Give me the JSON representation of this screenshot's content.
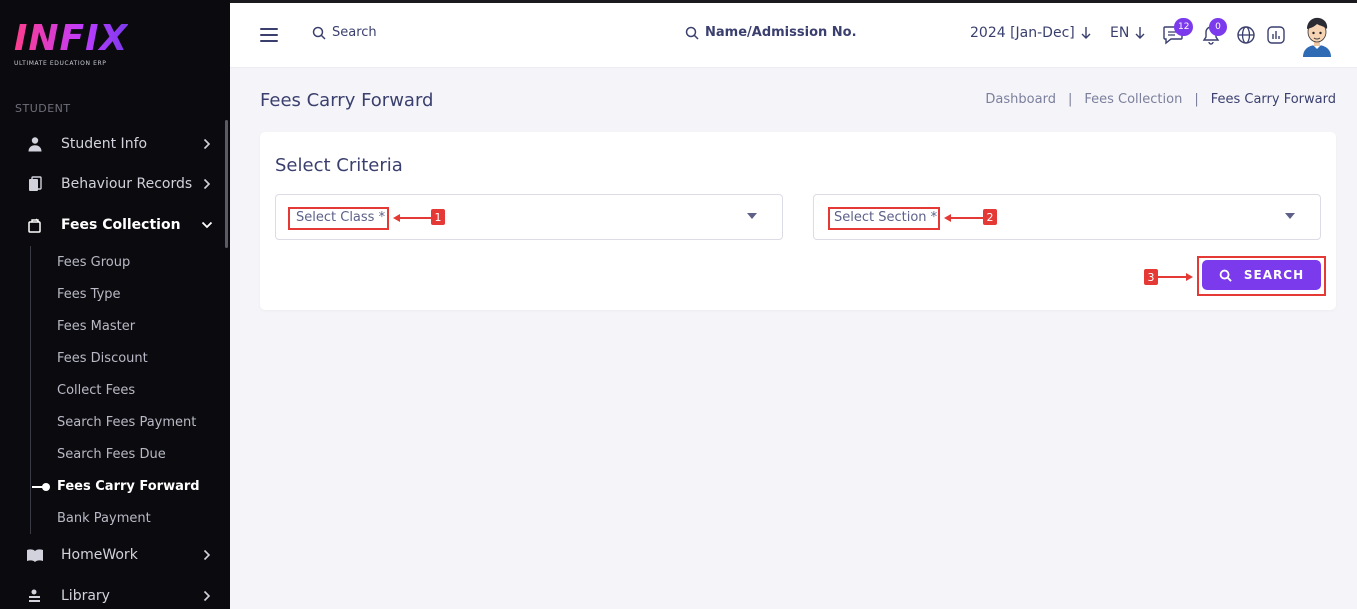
{
  "brand": {
    "logo": "INFIX",
    "tagline": "ULTIMATE EDUCATION ERP"
  },
  "sidebar": {
    "section": "STUDENT",
    "items": [
      {
        "label": "Student Info",
        "icon": "user-icon"
      },
      {
        "label": "Behaviour Records",
        "icon": "clipboard-icon"
      },
      {
        "label": "Fees Collection",
        "icon": "fees-icon"
      },
      {
        "label": "HomeWork",
        "icon": "book-icon"
      },
      {
        "label": "Library",
        "icon": "library-icon"
      }
    ],
    "sub_items": [
      "Fees Group",
      "Fees Type",
      "Fees Master",
      "Fees Discount",
      "Collect Fees",
      "Search Fees Payment",
      "Search Fees Due",
      "Fees Carry Forward",
      "Bank Payment"
    ]
  },
  "header": {
    "search_label": "Search",
    "admission_search": "Name/Admission No.",
    "year": "2024 [Jan-Dec]",
    "lang": "EN",
    "messages_count": "12",
    "notifications_count": "0"
  },
  "page": {
    "title": "Fees Carry Forward",
    "breadcrumb": [
      "Dashboard",
      "Fees Collection",
      "Fees Carry Forward"
    ]
  },
  "criteria": {
    "title": "Select Criteria",
    "class_placeholder": "Select Class *",
    "section_placeholder": "Select Section *",
    "search_button": "SEARCH"
  },
  "annotations": [
    "1",
    "2",
    "3"
  ],
  "colors": {
    "accent": "#7c3aed",
    "annotation": "#e53935",
    "sidebar": "#0b0b0f",
    "text": "#3a3f6e"
  }
}
